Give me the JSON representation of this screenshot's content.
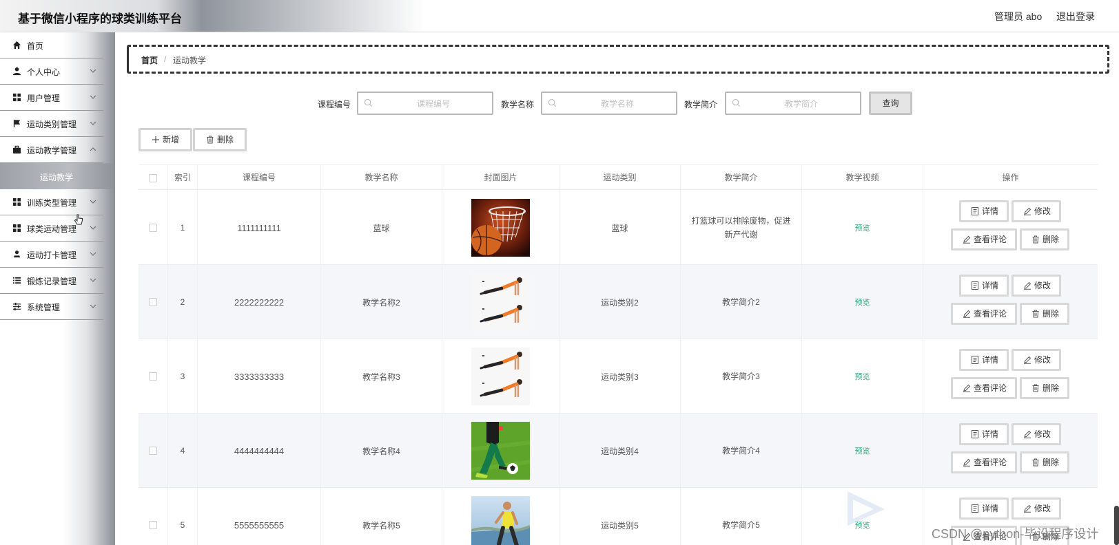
{
  "header": {
    "title": "基于微信小程序的球类训练平台",
    "user": "管理员 abo",
    "logout": "退出登录"
  },
  "sidebar": {
    "items": [
      {
        "label": "首页",
        "icon": "home-icon",
        "chevron": false
      },
      {
        "label": "个人中心",
        "icon": "person-icon",
        "chevron": true
      },
      {
        "label": "用户管理",
        "icon": "grid-icon",
        "chevron": true
      },
      {
        "label": "运动类别管理",
        "icon": "flag-icon",
        "chevron": true
      },
      {
        "label": "运动教学管理",
        "icon": "briefcase-icon",
        "chevron": true
      },
      {
        "label": "训练类型管理",
        "icon": "grid-icon",
        "chevron": true
      },
      {
        "label": "球类运动管理",
        "icon": "grid-icon",
        "chevron": true
      },
      {
        "label": "运动打卡管理",
        "icon": "person-stamp-icon",
        "chevron": true
      },
      {
        "label": "锻炼记录管理",
        "icon": "list-icon",
        "chevron": true
      },
      {
        "label": "系统管理",
        "icon": "sliders-icon",
        "chevron": true
      }
    ],
    "active_sub": "运动教学"
  },
  "breadcrumb": {
    "home": "首页",
    "separator": "/",
    "current": "运动教学"
  },
  "search": {
    "fields": [
      {
        "label": "课程编号",
        "placeholder": "课程编号"
      },
      {
        "label": "教学名称",
        "placeholder": "教学名称"
      },
      {
        "label": "教学简介",
        "placeholder": "教学简介"
      }
    ],
    "query_label": "查询"
  },
  "toolbar": {
    "add_label": "新增",
    "delete_label": "删除"
  },
  "table": {
    "headers": [
      "索引",
      "课程编号",
      "教学名称",
      "封面图片",
      "运动类别",
      "教学简介",
      "教学视频",
      "操作"
    ],
    "rows": [
      {
        "index": "1",
        "code": "1111111111",
        "name": "蓝球",
        "cover": "basketball",
        "category": "蓝球",
        "intro": "打篮球可以排除废物，促进新产代谢",
        "video": "预览"
      },
      {
        "index": "2",
        "code": "2222222222",
        "name": "教学名称2",
        "cover": "pushup",
        "category": "运动类别2",
        "intro": "教学简介2",
        "video": "预览"
      },
      {
        "index": "3",
        "code": "3333333333",
        "name": "教学名称3",
        "cover": "pushup",
        "category": "运动类别3",
        "intro": "教学简介3",
        "video": "预览"
      },
      {
        "index": "4",
        "code": "4444444444",
        "name": "教学名称4",
        "cover": "soccer",
        "category": "运动类别4",
        "intro": "教学简介4",
        "video": "预览"
      },
      {
        "index": "5",
        "code": "5555555555",
        "name": "教学名称5",
        "cover": "runner",
        "category": "运动类别5",
        "intro": "教学简介5",
        "video": "预览"
      }
    ],
    "actions": {
      "detail": "详情",
      "edit": "修改",
      "comments": "查看评论",
      "delete": "删除"
    }
  },
  "watermark": "CSDN @python-毕设程序设计",
  "colors": {
    "preview_link": "#3aa57a",
    "row_alt": "#f5f6fa",
    "sidebar_active": "#9ea2a8"
  }
}
